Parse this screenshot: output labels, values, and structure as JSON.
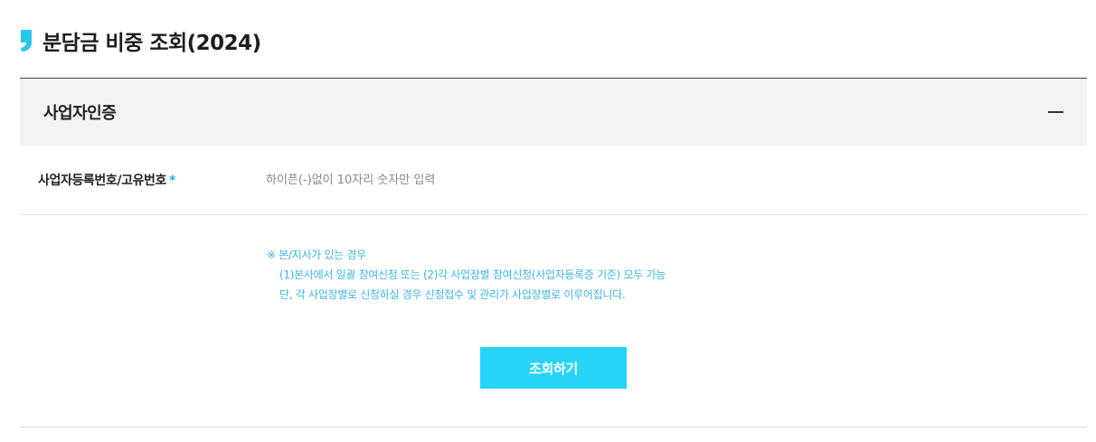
{
  "page": {
    "title": "분담금 비중 조회(2024)"
  },
  "section": {
    "title": "사업자인증",
    "collapse_icon": "minus-icon"
  },
  "form": {
    "business_number": {
      "label": "사업자등록번호/고유번호",
      "required_mark": "*",
      "value": "",
      "placeholder": "하이픈(-)없이 10자리 숫자만 입력"
    }
  },
  "notice": {
    "line1": "※ 본/지사가 있는 경우",
    "line2": "(1)본사에서 일괄 참여신청 또는 (2)각 사업장별 참여신청(사업자등록증 기준) 모두 가능",
    "line3": "단, 각 사업장별로 신청하실 경우 신청접수 및 관리가 사업장별로 이루어집니다."
  },
  "actions": {
    "search_label": "조회하기"
  },
  "colors": {
    "accent": "#27d3f7",
    "notice_text": "#3fb6e0",
    "required_mark": "#1fb8d8",
    "header_bg": "#f3f3f5"
  }
}
